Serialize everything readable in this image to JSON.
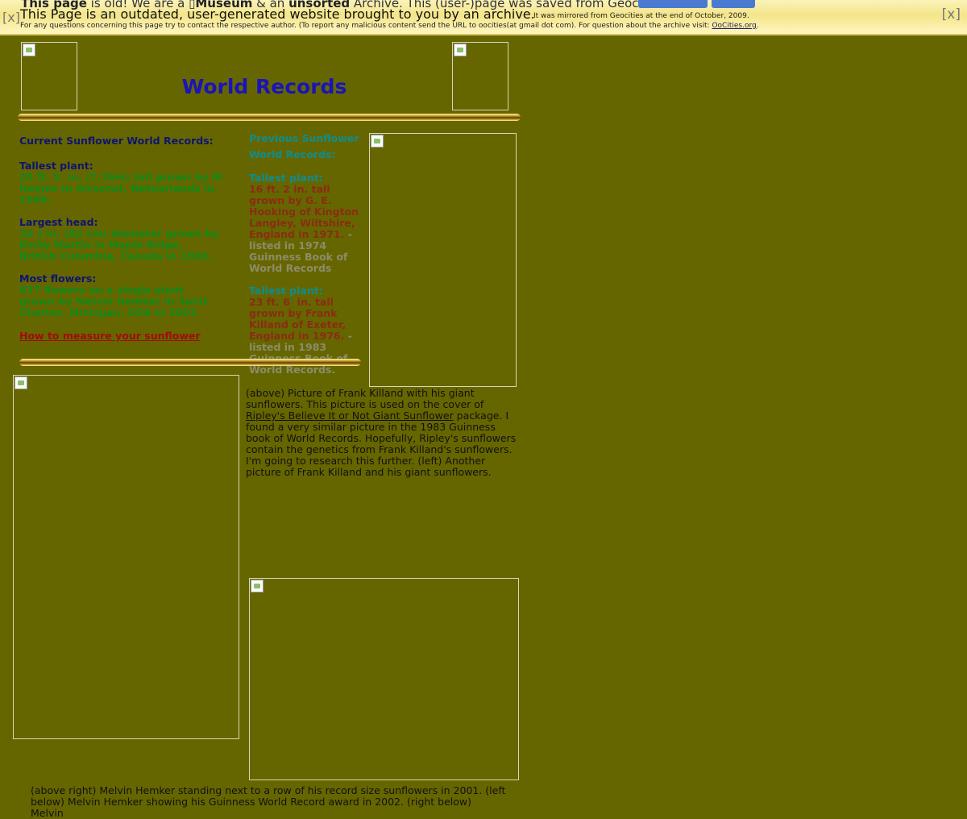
{
  "banner": {
    "behind_text_bold1": "This page",
    "behind_text_mid1": " is old! We are a ",
    "behind_text_bold2": "Museum",
    "behind_text_mid2": " & an ",
    "behind_text_bold3": "unsorted",
    "behind_text_tail": " Archive. This (user-)page was saved from Geoc",
    "title": "This Page is an outdated, user-generated website brought to you by an archive.",
    "mirror_note": "It was mirrored from Geocities at the end of October, 2009.",
    "contact_note": "For any questions concerning this page try to contact the respective author. (To report any malicious content send the URL to oocities(at gmail dot com). For question about the archive visit: ",
    "archive_link": "OoCities.org",
    "contact_end": ".",
    "close_label": "[x]"
  },
  "page": {
    "title": "World Records"
  },
  "current": {
    "heading": "Current Sunflower World Records:",
    "tallest_label": "Tallest plant:",
    "tallest_text": "25 ft. 5  in. (7.76m) tall grown by M Heijms in Oirschot, Netherlands in 1986.",
    "head_label": "Largest head:",
    "head_text": "32 z in. (82 cm) diameter grown by Emily Martin in Maple Ridge, British Columbia, Canada in 1983.",
    "flowers_label": "Most flowers:",
    "flowers_text": "837 flowers on a single plant grown by Melvin Hemker in Saint Charles, Michigan, USA in 2001.",
    "measure_link": "How to measure your sunflower"
  },
  "previous": {
    "heading1": "Previous Sunflower",
    "heading2": "World Records:",
    "p1_label": "Tallest plant:",
    "p1_text": "16 ft. 2 in. tall grown by G. E. Hooking of Kington Langley, Wiltshire, England in 1971.",
    "p1_note": " - listed in 1974 Guinness Book of World Records",
    "p2_label": "Tallest plant:",
    "p2_text": "23 ft. 6  in.  tall grown by Frank Killand  of Exeter, England  in 1976.",
    "p2_note": " - listed in 1983 Guinness Book of World Records."
  },
  "captions": {
    "killand_pre": "(above) Picture of Frank Killand with his giant sunflowers.  This picture is used on the cover of ",
    "killand_link": "Ripley's Believe It or Not Giant Sunflower",
    "killand_post": " package.  I found a very similar picture in the 1983 Guinness book of World Records.  Hopefully, Ripley's sunflowers contain the genetics from Frank Killand's sunflowers.  I'm going to research this further. (left) Another picture of Frank Killand and his giant sunflowers.",
    "hemker": "(above right) Melvin Hemker standing next to a row of his record size sunflowers in 2001.  (left below) Melvin Hemker showing his Guinness World Record award in 2002.  (right below)  Melvin"
  }
}
